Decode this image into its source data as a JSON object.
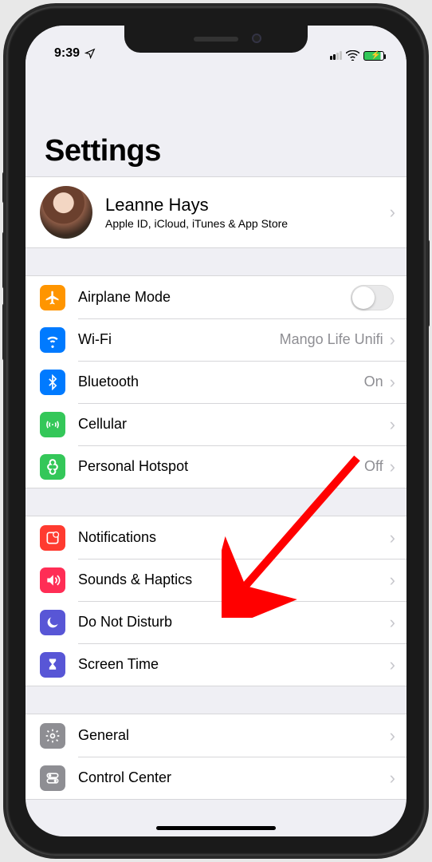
{
  "status": {
    "time": "9:39",
    "location_icon": "location-arrow",
    "wifi_icon": "wifi",
    "battery_icon": "battery-charging"
  },
  "page_title": "Settings",
  "profile": {
    "name": "Leanne Hays",
    "subtitle": "Apple ID, iCloud, iTunes & App Store"
  },
  "groups": [
    {
      "id": "connectivity",
      "rows": [
        {
          "id": "airplane",
          "icon": "airplane-icon",
          "color": "ic-orange",
          "label": "Airplane Mode",
          "control": "toggle",
          "toggle_on": false
        },
        {
          "id": "wifi",
          "icon": "wifi-icon",
          "color": "ic-blue",
          "label": "Wi-Fi",
          "control": "disclosure",
          "value": "Mango Life Unifi"
        },
        {
          "id": "bluetooth",
          "icon": "bluetooth-icon",
          "color": "ic-blue",
          "label": "Bluetooth",
          "control": "disclosure",
          "value": "On"
        },
        {
          "id": "cellular",
          "icon": "cellular-icon",
          "color": "ic-green",
          "label": "Cellular",
          "control": "disclosure",
          "value": ""
        },
        {
          "id": "hotspot",
          "icon": "hotspot-icon",
          "color": "ic-green",
          "label": "Personal Hotspot",
          "control": "disclosure",
          "value": "Off"
        }
      ]
    },
    {
      "id": "alerts",
      "rows": [
        {
          "id": "notifications",
          "icon": "notifications-icon",
          "color": "ic-red",
          "label": "Notifications",
          "control": "disclosure",
          "value": ""
        },
        {
          "id": "sounds",
          "icon": "speaker-icon",
          "color": "ic-pink",
          "label": "Sounds & Haptics",
          "control": "disclosure",
          "value": ""
        },
        {
          "id": "dnd",
          "icon": "moon-icon",
          "color": "ic-purple",
          "label": "Do Not Disturb",
          "control": "disclosure",
          "value": ""
        },
        {
          "id": "screentime",
          "icon": "hourglass-icon",
          "color": "ic-purple",
          "label": "Screen Time",
          "control": "disclosure",
          "value": ""
        }
      ]
    },
    {
      "id": "system",
      "rows": [
        {
          "id": "general",
          "icon": "gear-icon",
          "color": "ic-gray",
          "label": "General",
          "control": "disclosure",
          "value": ""
        },
        {
          "id": "control-center",
          "icon": "switches-icon",
          "color": "ic-gray",
          "label": "Control Center",
          "control": "disclosure",
          "value": ""
        }
      ]
    }
  ],
  "annotation": {
    "target_row": "sounds",
    "color": "#ff0000"
  }
}
